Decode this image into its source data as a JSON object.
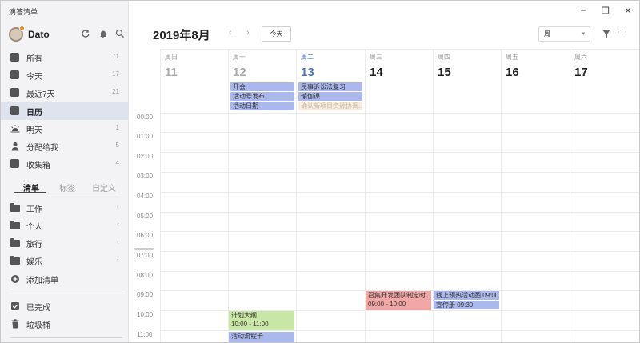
{
  "app": {
    "title": "滴答清单"
  },
  "user": {
    "name": "Dato"
  },
  "window_controls": {
    "minimize": "–",
    "restore": "❐",
    "close": "✕"
  },
  "sidebar": {
    "smart_lists": [
      {
        "label": "所有",
        "count": "71",
        "icon": "inbox-icon"
      },
      {
        "label": "今天",
        "count": "17",
        "icon": "calendar-today-icon"
      },
      {
        "label": "最近7天",
        "count": "21",
        "icon": "calendar-week-icon"
      },
      {
        "label": "日历",
        "count": "",
        "icon": "calendar-icon"
      },
      {
        "label": "明天",
        "count": "1",
        "icon": "sunrise-icon"
      },
      {
        "label": "分配给我",
        "count": "5",
        "icon": "person-icon"
      },
      {
        "label": "收集箱",
        "count": "4",
        "icon": "tray-icon"
      }
    ],
    "tabs": [
      "清单",
      "标签",
      "自定义"
    ],
    "folders": [
      {
        "label": "工作",
        "chevron": "‹"
      },
      {
        "label": "个人",
        "chevron": "‹"
      },
      {
        "label": "旅行",
        "chevron": "‹"
      },
      {
        "label": "娱乐",
        "chevron": "‹"
      }
    ],
    "add_list": "添加清单",
    "completed": "已完成",
    "trash": "垃圾桶"
  },
  "toolbar": {
    "month_title": "2019年8月",
    "prev": "‹",
    "next": "›",
    "today": "今天",
    "view": "周",
    "more": "···"
  },
  "days": [
    {
      "name": "周日",
      "num": "11"
    },
    {
      "name": "周一",
      "num": "12"
    },
    {
      "name": "周二",
      "num": "13"
    },
    {
      "name": "周三",
      "num": "14"
    },
    {
      "name": "周四",
      "num": "15"
    },
    {
      "name": "周五",
      "num": "16"
    },
    {
      "name": "周六",
      "num": "17"
    }
  ],
  "all_day": {
    "mon": [
      "开会",
      "活动号发布",
      "活动日期"
    ],
    "tue": [
      "民事诉讼法复习",
      "瑜伽课",
      "确认新项目资源协调..."
    ]
  },
  "hours": [
    "00:00",
    "01:00",
    "02:00",
    "03:00",
    "04:00",
    "05:00",
    "06:00",
    "07:00",
    "08:00",
    "09:00",
    "10:00",
    "11:00"
  ],
  "events": {
    "wed_1": {
      "title": "召集开发团队制定时...",
      "time": "09:00 - 10:00"
    },
    "thu_1": {
      "title": "线上预热活动图 09:00 -"
    },
    "thu_2": {
      "title": "宣传册 09:30"
    },
    "mon_1": {
      "title": "计划大纲",
      "time": "10:00 - 11:00"
    },
    "mon_2": {
      "title": "活动流程卡"
    }
  },
  "colors": {
    "accent": "#4a72c9",
    "event_blue": "#aab8ee",
    "event_red": "#f2a7a7",
    "event_green": "#c8e6a6",
    "event_faded": "#f7ede0"
  }
}
